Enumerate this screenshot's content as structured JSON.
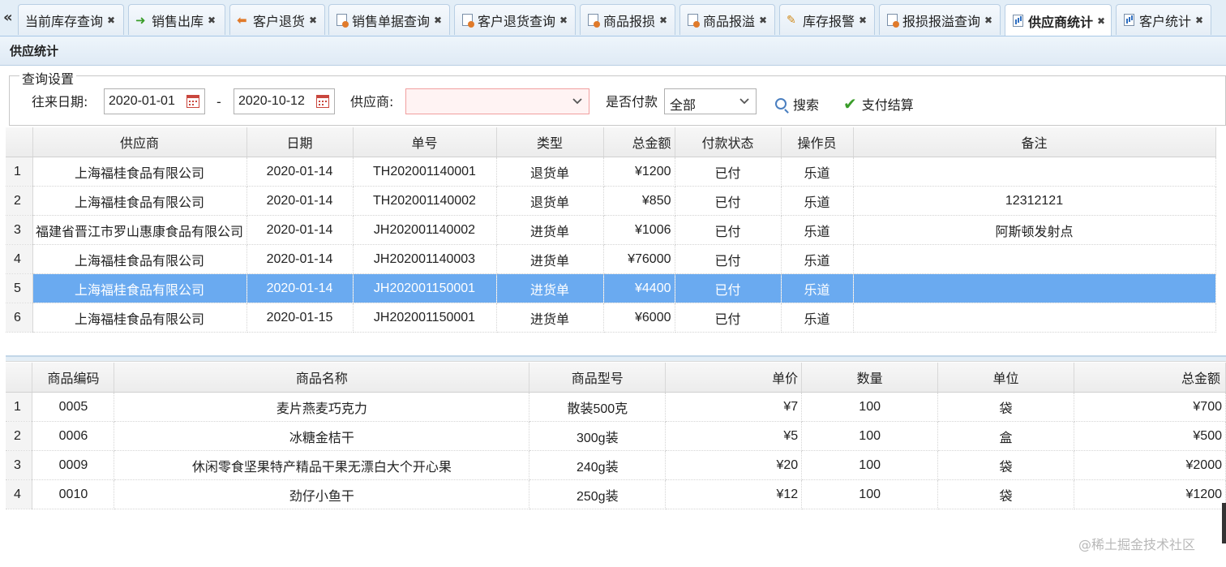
{
  "tabs": [
    {
      "label": "当前库存查询",
      "icon": "doc-icon"
    },
    {
      "label": "销售出库",
      "icon": "arrow-right-icon"
    },
    {
      "label": "客户退货",
      "icon": "arrow-left-icon"
    },
    {
      "label": "销售单据查询",
      "icon": "doc-icon"
    },
    {
      "label": "客户退货查询",
      "icon": "doc-icon"
    },
    {
      "label": "商品报损",
      "icon": "doc-icon"
    },
    {
      "label": "商品报溢",
      "icon": "doc-icon"
    },
    {
      "label": "库存报警",
      "icon": "pencil-icon"
    },
    {
      "label": "报损报溢查询",
      "icon": "doc-icon"
    },
    {
      "label": "供应商统计",
      "icon": "chart-icon",
      "active": true
    },
    {
      "label": "客户统计",
      "icon": "chart-icon"
    }
  ],
  "panel": {
    "title": "供应统计"
  },
  "query": {
    "legend": "查询设置",
    "date_label": "往来日期:",
    "date_from": "2020-01-01",
    "date_sep": "-",
    "date_to": "2020-10-12",
    "supplier_label": "供应商:",
    "supplier_value": "",
    "paid_label": "是否付款",
    "paid_value": "全部",
    "search_label": "搜索",
    "settle_label": "支付结算"
  },
  "orders": {
    "columns": [
      "供应商",
      "日期",
      "单号",
      "类型",
      "总金额",
      "付款状态",
      "操作员",
      "备注"
    ],
    "rows": [
      {
        "n": "1",
        "supplier": "上海福桂食品有限公司",
        "date": "2020-01-14",
        "no": "TH202001140001",
        "type": "退货单",
        "amount": "¥1200",
        "status": "已付",
        "operator": "乐道",
        "remark": ""
      },
      {
        "n": "2",
        "supplier": "上海福桂食品有限公司",
        "date": "2020-01-14",
        "no": "TH202001140002",
        "type": "退货单",
        "amount": "¥850",
        "status": "已付",
        "operator": "乐道",
        "remark": "12312121"
      },
      {
        "n": "3",
        "supplier": "福建省晋江市罗山惠康食品有限公司",
        "date": "2020-01-14",
        "no": "JH202001140002",
        "type": "进货单",
        "amount": "¥1006",
        "status": "已付",
        "operator": "乐道",
        "remark": "阿斯顿发射点"
      },
      {
        "n": "4",
        "supplier": "上海福桂食品有限公司",
        "date": "2020-01-14",
        "no": "JH202001140003",
        "type": "进货单",
        "amount": "¥76000",
        "status": "已付",
        "operator": "乐道",
        "remark": ""
      },
      {
        "n": "5",
        "supplier": "上海福桂食品有限公司",
        "date": "2020-01-14",
        "no": "JH202001150001",
        "type": "进货单",
        "amount": "¥4400",
        "status": "已付",
        "operator": "乐道",
        "remark": "",
        "selected": true
      },
      {
        "n": "6",
        "supplier": "上海福桂食品有限公司",
        "date": "2020-01-15",
        "no": "JH202001150001",
        "type": "进货单",
        "amount": "¥6000",
        "status": "已付",
        "operator": "乐道",
        "remark": ""
      }
    ]
  },
  "items": {
    "columns": [
      "商品编码",
      "商品名称",
      "商品型号",
      "单价",
      "数量",
      "单位",
      "总金额"
    ],
    "rows": [
      {
        "n": "1",
        "code": "0005",
        "name": "麦片燕麦巧克力",
        "model": "散装500克",
        "price": "¥7",
        "qty": "100",
        "unit": "袋",
        "total": "¥700"
      },
      {
        "n": "2",
        "code": "0006",
        "name": "冰糖金桔干",
        "model": "300g装",
        "price": "¥5",
        "qty": "100",
        "unit": "盒",
        "total": "¥500"
      },
      {
        "n": "3",
        "code": "0009",
        "name": "休闲零食坚果特产精品干果无漂白大个开心果",
        "model": "240g装",
        "price": "¥20",
        "qty": "100",
        "unit": "袋",
        "total": "¥2000"
      },
      {
        "n": "4",
        "code": "0010",
        "name": "劲仔小鱼干",
        "model": "250g装",
        "price": "¥12",
        "qty": "100",
        "unit": "袋",
        "total": "¥1200"
      }
    ]
  },
  "watermark": "@稀土掘金技术社区"
}
